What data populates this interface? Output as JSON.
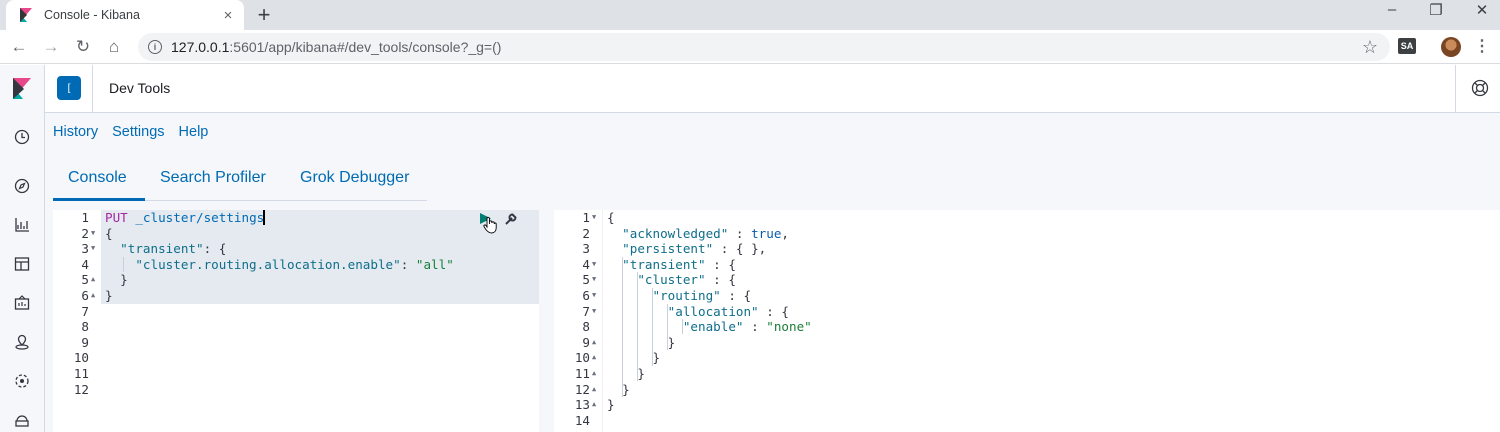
{
  "browser": {
    "tab_title": "Console - Kibana",
    "tab_close": "×",
    "new_tab": "+",
    "url_host": "127.0.0.1",
    "url_rest": ":5601/app/kibana#/dev_tools/console?_g=()",
    "extension_label": "SA",
    "icons": [
      "back-icon",
      "forward-icon",
      "reload-icon",
      "home-icon",
      "info-icon",
      "star-icon",
      "minimize-icon",
      "maximize-icon",
      "close-icon"
    ]
  },
  "kibana": {
    "space_initial": "[",
    "app_title": "Dev Tools",
    "topnav": [
      "History",
      "Settings",
      "Help"
    ],
    "tabs": [
      "Console",
      "Search Profiler",
      "Grok Debugger"
    ],
    "accent": "#006bb4"
  },
  "editor": {
    "request_lines": [
      [
        [
          "PUT",
          "method"
        ],
        [
          " _cluster/settings",
          "url"
        ]
      ],
      [
        [
          "{",
          "punc"
        ]
      ],
      [
        [
          "  \"transient\"",
          "key"
        ],
        [
          ": {",
          "punc"
        ]
      ],
      [
        [
          "    \"cluster.routing.allocation.enable\"",
          "key"
        ],
        [
          ": ",
          "punc"
        ],
        [
          "\"all\"",
          "str"
        ]
      ],
      [
        [
          "  }",
          "punc"
        ]
      ],
      [
        [
          "}",
          "punc"
        ]
      ],
      [],
      [],
      [],
      [],
      [],
      []
    ],
    "request_line_numbers": [
      "1",
      "2",
      "3",
      "4",
      "5",
      "6",
      "7",
      "8",
      "9",
      "10",
      "11",
      "12"
    ],
    "request_folds": {
      "2": "down",
      "3": "down",
      "5": "up",
      "6": "up"
    },
    "response_lines": [
      [
        [
          "{",
          "punc"
        ]
      ],
      [
        [
          "  \"acknowledged\"",
          "key"
        ],
        [
          " : ",
          "punc"
        ],
        [
          "true",
          "bool"
        ],
        [
          ",",
          "punc"
        ]
      ],
      [
        [
          "  \"persistent\"",
          "key"
        ],
        [
          " : { },",
          "punc"
        ]
      ],
      [
        [
          "  \"transient\"",
          "key"
        ],
        [
          " : {",
          "punc"
        ]
      ],
      [
        [
          "    \"cluster\"",
          "key"
        ],
        [
          " : {",
          "punc"
        ]
      ],
      [
        [
          "      \"routing\"",
          "key"
        ],
        [
          " : {",
          "punc"
        ]
      ],
      [
        [
          "        \"allocation\"",
          "key"
        ],
        [
          " : {",
          "punc"
        ]
      ],
      [
        [
          "          \"enable\"",
          "key"
        ],
        [
          " : ",
          "punc"
        ],
        [
          "\"none\"",
          "str"
        ]
      ],
      [
        [
          "        }",
          "punc"
        ]
      ],
      [
        [
          "      }",
          "punc"
        ]
      ],
      [
        [
          "    }",
          "punc"
        ]
      ],
      [
        [
          "  }",
          "punc"
        ]
      ],
      [
        [
          "}",
          "punc"
        ]
      ],
      []
    ],
    "response_line_numbers": [
      "1",
      "2",
      "3",
      "4",
      "5",
      "6",
      "7",
      "8",
      "9",
      "10",
      "11",
      "12",
      "13",
      "14"
    ],
    "response_folds": {
      "1": "down",
      "4": "down",
      "5": "down",
      "6": "down",
      "7": "down",
      "9": "up",
      "10": "up",
      "11": "up",
      "12": "up",
      "13": "up"
    }
  }
}
